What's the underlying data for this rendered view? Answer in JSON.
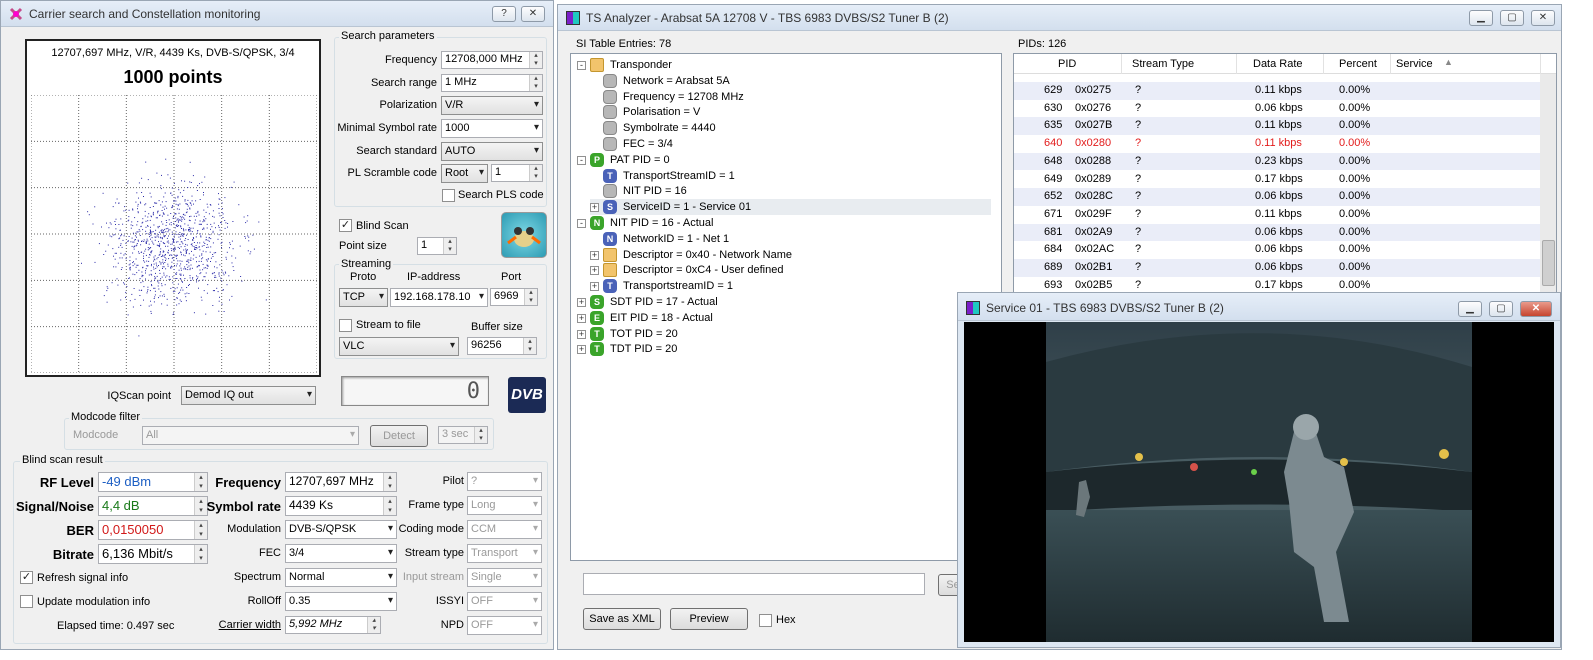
{
  "left_window": {
    "title": "Carrier search and Constellation monitoring",
    "help": "?",
    "close": "✕"
  },
  "constellation": {
    "info": "12707,697 MHz, V/R, 4439 Ks, DVB-S/QPSK, 3/4",
    "points_label": "1000 points",
    "point_count": 1000
  },
  "search": {
    "group": "Search parameters",
    "frequency_label": "Frequency",
    "frequency": "12708,000 MHz",
    "range_label": "Search range",
    "range": "1 MHz",
    "polarization_label": "Polarization",
    "polarization": "V/R",
    "min_sr_label": "Minimal Symbol rate",
    "min_sr": "1000",
    "standard_label": "Search standard",
    "standard": "AUTO",
    "pls_label": "PL Scramble code",
    "pls_mode": "Root",
    "pls_value": "1",
    "search_pls_label": "Search PLS code"
  },
  "blind_scan_label": "Blind Scan",
  "point_size_label": "Point size",
  "point_size": "1",
  "streaming": {
    "group": "Streaming",
    "proto_label": "Proto",
    "ip_label": "IP-address",
    "port_label": "Port",
    "proto": "TCP",
    "ip": "192.168.178.10",
    "port": "6969",
    "stream_file_label": "Stream to file",
    "buffer_label": "Buffer size",
    "player": "VLC",
    "buffer": "96256"
  },
  "iq": {
    "label": "IQScan point",
    "value": "Demod IQ out",
    "lcd": "0"
  },
  "dvb_logo": "DVB",
  "modcode": {
    "group": "Modcode filter",
    "label": "Modcode",
    "value": "All",
    "detect": "Detect",
    "time": "3 sec"
  },
  "result": {
    "group": "Blind scan result",
    "rf_label": "RF Level",
    "rf": "-49 dBm",
    "snr_label": "Signal/Noise",
    "snr": "4,4 dB",
    "ber_label": "BER",
    "ber": "0,0150050",
    "bitrate_label": "Bitrate",
    "bitrate": "6,136 Mbit/s",
    "freq_label": "Frequency",
    "freq": "12707,697 MHz",
    "sr_label": "Symbol rate",
    "sr": "4439 Ks",
    "mod_label": "Modulation",
    "mod": "DVB-S/QPSK",
    "fec_label": "FEC",
    "fec": "3/4",
    "spectrum_label": "Spectrum",
    "spectrum": "Normal",
    "rolloff_label": "RollOff",
    "rolloff": "0.35",
    "carrier_width_label": "Carrier width",
    "carrier_width": "5,992 MHz",
    "pilot_label": "Pilot",
    "pilot": "?",
    "frame_label": "Frame type",
    "frame": "Long",
    "coding_label": "Coding mode",
    "coding": "CCM",
    "stype_label": "Stream type",
    "stype": "Transport",
    "input_label": "Input stream",
    "input": "Single",
    "issyi_label": "ISSYI",
    "issyi": "OFF",
    "npd_label": "NPD",
    "npd": "OFF",
    "refresh_label": "Refresh signal info",
    "update_label": "Update modulation info",
    "elapsed": "Elapsed time: 0.497 sec"
  },
  "ts": {
    "title": "TS Analyzer - Arabsat 5A 12708 V - TBS 6983 DVBS/S2 Tuner B (2)",
    "si_header": "SI Table Entries: 78",
    "pids_header": "PIDs: 126",
    "tree": [
      {
        "d": 0,
        "exp": "−",
        "icon": "folder",
        "t": "Transponder"
      },
      {
        "d": 1,
        "icon": "grey",
        "t": "Network = Arabsat 5A"
      },
      {
        "d": 1,
        "icon": "grey",
        "t": "Frequency = 12708 MHz"
      },
      {
        "d": 1,
        "icon": "grey",
        "t": "Polarisation = V"
      },
      {
        "d": 1,
        "icon": "grey",
        "t": "Symbolrate = 4440"
      },
      {
        "d": 1,
        "icon": "grey",
        "t": "FEC = 3/4"
      },
      {
        "d": 0,
        "exp": "−",
        "icon": "green",
        "letter": "P",
        "t": "PAT PID = 0"
      },
      {
        "d": 1,
        "icon": "blue",
        "letter": "T",
        "t": "TransportStreamID = 1"
      },
      {
        "d": 1,
        "icon": "grey",
        "t": "NIT PID = 16"
      },
      {
        "d": 1,
        "exp": "+",
        "icon": "blue",
        "letter": "S",
        "t": "ServiceID = 1 - Service 01"
      },
      {
        "d": 0,
        "exp": "−",
        "icon": "green",
        "letter": "N",
        "t": "NIT PID = 16 - Actual"
      },
      {
        "d": 1,
        "icon": "blue",
        "letter": "N",
        "t": "NetworkID = 1 - Net 1"
      },
      {
        "d": 1,
        "exp": "+",
        "icon": "folder",
        "t": "Descriptor = 0x40 - Network Name"
      },
      {
        "d": 1,
        "exp": "+",
        "icon": "folder",
        "t": "Descriptor = 0xC4 - User defined"
      },
      {
        "d": 1,
        "exp": "+",
        "icon": "blue",
        "letter": "T",
        "t": "TransportstreamID = 1"
      },
      {
        "d": 0,
        "exp": "+",
        "icon": "green",
        "letter": "S",
        "t": "SDT PID = 17 - Actual"
      },
      {
        "d": 0,
        "exp": "+",
        "icon": "green",
        "letter": "E",
        "t": "EIT PID = 18 - Actual"
      },
      {
        "d": 0,
        "exp": "+",
        "icon": "green",
        "letter": "T",
        "t": "TOT PID = 20"
      },
      {
        "d": 0,
        "exp": "+",
        "icon": "green",
        "letter": "T",
        "t": "TDT PID = 20"
      }
    ],
    "columns": [
      "PID",
      "Stream Type",
      "Data Rate",
      "Percent",
      "Service"
    ],
    "rows": [
      {
        "pid": "629",
        "hex": "0x0275",
        "type": "?",
        "rate": "0.11 kbps",
        "pct": "0.00%"
      },
      {
        "pid": "630",
        "hex": "0x0276",
        "type": "?",
        "rate": "0.06 kbps",
        "pct": "0.00%"
      },
      {
        "pid": "635",
        "hex": "0x027B",
        "type": "?",
        "rate": "0.11 kbps",
        "pct": "0.00%"
      },
      {
        "pid": "640",
        "hex": "0x0280",
        "type": "?",
        "rate": "0.11 kbps",
        "pct": "0.00%",
        "red": true
      },
      {
        "pid": "648",
        "hex": "0x0288",
        "type": "?",
        "rate": "0.23 kbps",
        "pct": "0.00%"
      },
      {
        "pid": "649",
        "hex": "0x0289",
        "type": "?",
        "rate": "0.17 kbps",
        "pct": "0.00%"
      },
      {
        "pid": "652",
        "hex": "0x028C",
        "type": "?",
        "rate": "0.06 kbps",
        "pct": "0.00%"
      },
      {
        "pid": "671",
        "hex": "0x029F",
        "type": "?",
        "rate": "0.11 kbps",
        "pct": "0.00%"
      },
      {
        "pid": "681",
        "hex": "0x02A9",
        "type": "?",
        "rate": "0.06 kbps",
        "pct": "0.00%"
      },
      {
        "pid": "684",
        "hex": "0x02AC",
        "type": "?",
        "rate": "0.06 kbps",
        "pct": "0.00%"
      },
      {
        "pid": "689",
        "hex": "0x02B1",
        "type": "?",
        "rate": "0.06 kbps",
        "pct": "0.00%"
      },
      {
        "pid": "693",
        "hex": "0x02B5",
        "type": "?",
        "rate": "0.17 kbps",
        "pct": "0.00%"
      }
    ],
    "save_xml": "Save as XML",
    "preview": "Preview",
    "hex": "Hex",
    "search_btn": "Se"
  },
  "video": {
    "title": "Service 01 - TBS 6983 DVBS/S2 Tuner B (2)"
  },
  "colors": {
    "rf": "#1d5fc4",
    "snr": "#1a7a1a",
    "ber": "#d11919",
    "red_row": "#e21b1b",
    "constellation": "#2a2aa8"
  }
}
